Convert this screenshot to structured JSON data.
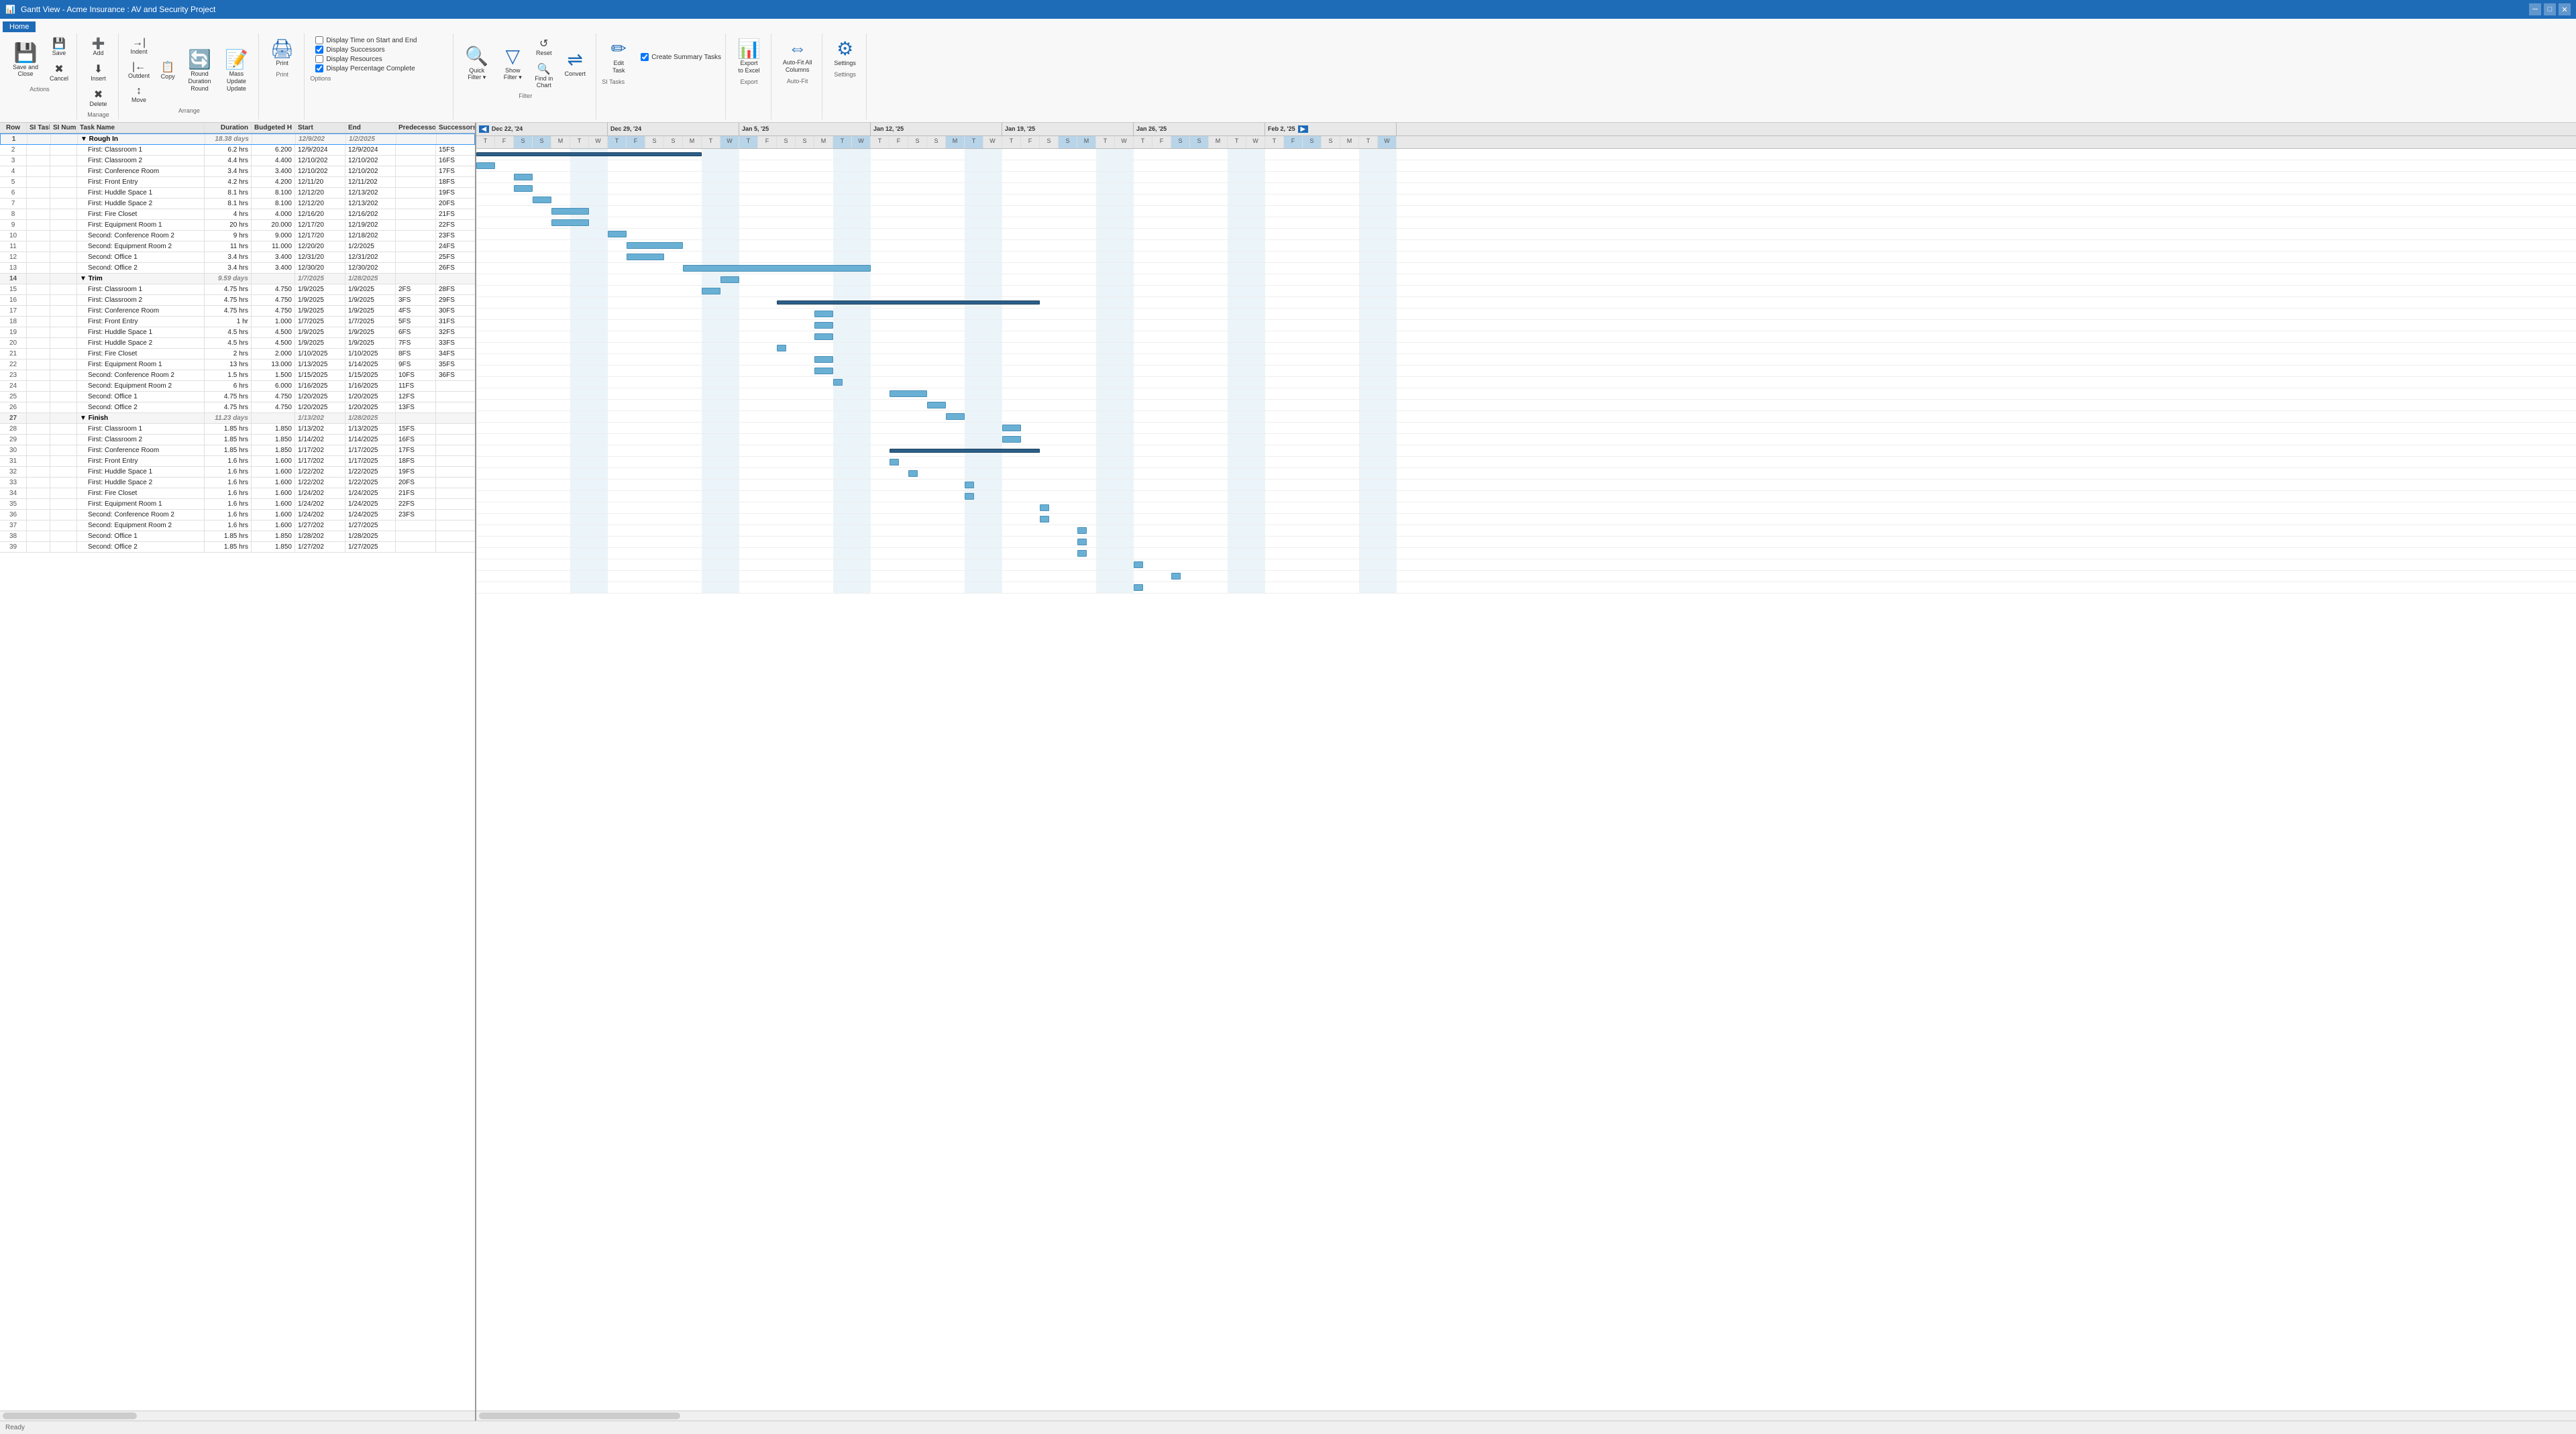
{
  "app": {
    "title": "Gantt View - Acme Insurance : AV and Security Project",
    "home_tab": "Home"
  },
  "ribbon": {
    "groups": [
      {
        "name": "Actions",
        "buttons": [
          {
            "id": "save-close",
            "label": "Save and\nClose",
            "icon": "💾"
          },
          {
            "id": "save",
            "label": "Save",
            "icon": "💾"
          },
          {
            "id": "cancel",
            "label": "Cancel",
            "icon": "✖"
          }
        ]
      },
      {
        "name": "Manage",
        "buttons": [
          {
            "id": "add",
            "label": "Add",
            "icon": "➕"
          },
          {
            "id": "insert",
            "label": "Insert",
            "icon": "⬇"
          },
          {
            "id": "delete",
            "label": "Delete",
            "icon": "✖"
          }
        ]
      },
      {
        "name": "Arrange",
        "buttons": [
          {
            "id": "indent",
            "label": "Indent",
            "icon": "→"
          },
          {
            "id": "outdent",
            "label": "Outdent",
            "icon": "←"
          },
          {
            "id": "move",
            "label": "Move",
            "icon": "↕"
          },
          {
            "id": "copy",
            "label": "Copy",
            "icon": "📋"
          },
          {
            "id": "round-duration",
            "label": "Round\nDuration\nRound",
            "icon": "🔄"
          },
          {
            "id": "mass-update",
            "label": "Mass\nUpdate\nUpdate",
            "icon": "📝"
          }
        ]
      },
      {
        "name": "Print",
        "buttons": [
          {
            "id": "print",
            "label": "Print",
            "icon": "🖨"
          }
        ]
      },
      {
        "name": "Options",
        "checkboxes": [
          {
            "id": "display-time",
            "label": "Display Time on Start and End",
            "checked": false
          },
          {
            "id": "display-resources",
            "label": "Display Resources",
            "checked": false
          },
          {
            "id": "display-pct",
            "label": "Display Percentage Complete",
            "checked": true
          }
        ],
        "checkbox_successors": {
          "label": "Display Successors",
          "checked": true
        }
      },
      {
        "name": "Filter",
        "buttons": [
          {
            "id": "quick-filter",
            "label": "Quick\nFilter ▾",
            "icon": "🔍"
          },
          {
            "id": "show-filter",
            "label": "Show\nFilter ▾",
            "icon": "🔽"
          },
          {
            "id": "reset",
            "label": "Reset",
            "icon": "↺"
          },
          {
            "id": "find-in-chart",
            "label": "Find in\nChart",
            "icon": "🔍"
          },
          {
            "id": "convert",
            "label": "Convert",
            "icon": "🔄"
          }
        ]
      },
      {
        "name": "SI Tasks",
        "buttons": [
          {
            "id": "edit-task",
            "label": "Edit\nTask",
            "icon": "✏"
          }
        ],
        "checkbox_create": {
          "label": "Create Summary Tasks",
          "checked": true
        }
      },
      {
        "name": "Export",
        "buttons": [
          {
            "id": "export-excel",
            "label": "Export\nto Excel",
            "icon": "📊"
          }
        ]
      },
      {
        "name": "Auto-Fit",
        "buttons": [
          {
            "id": "auto-fit-all",
            "label": "Auto-Fit All\nColumns",
            "icon": "⇔"
          }
        ]
      },
      {
        "name": "Settings",
        "buttons": [
          {
            "id": "settings",
            "label": "Settings",
            "icon": "⚙"
          }
        ]
      }
    ]
  },
  "grid": {
    "columns": [
      "Row",
      "SI Task",
      "SI Number",
      "Task Name",
      "Duration",
      "Budgeted H",
      "Start",
      "End",
      "Predecessors",
      "Successors"
    ],
    "rows": [
      {
        "row": 1,
        "si_task": "",
        "si_number": "",
        "task_name": "Rough In",
        "duration": "18.38 days",
        "budgeted": "",
        "start": "12/9/202",
        "end": "1/2/2025",
        "pred": "",
        "succ": "",
        "type": "summary",
        "level": 0
      },
      {
        "row": 2,
        "si_task": "",
        "si_number": "",
        "task_name": "First: Classroom 1",
        "duration": "6.2 hrs",
        "budgeted": "6.200",
        "start": "12/9/2024",
        "end": "12/9/2024",
        "pred": "",
        "succ": "15FS",
        "type": "task",
        "level": 1
      },
      {
        "row": 3,
        "si_task": "",
        "si_number": "",
        "task_name": "First: Classroom 2",
        "duration": "4.4 hrs",
        "budgeted": "4.400",
        "start": "12/10/202",
        "end": "12/10/202",
        "pred": "",
        "succ": "16FS",
        "type": "task",
        "level": 1
      },
      {
        "row": 4,
        "si_task": "",
        "si_number": "",
        "task_name": "First: Conference Room",
        "duration": "3.4 hrs",
        "budgeted": "3.400",
        "start": "12/10/202",
        "end": "12/10/202",
        "pred": "",
        "succ": "17FS",
        "type": "task",
        "level": 1
      },
      {
        "row": 5,
        "si_task": "",
        "si_number": "",
        "task_name": "First: Front Entry",
        "duration": "4.2 hrs",
        "budgeted": "4.200",
        "start": "12/11/20",
        "end": "12/11/202",
        "pred": "",
        "succ": "18FS",
        "type": "task",
        "level": 1
      },
      {
        "row": 6,
        "si_task": "",
        "si_number": "",
        "task_name": "First: Huddle Space 1",
        "duration": "8.1 hrs",
        "budgeted": "8.100",
        "start": "12/12/20",
        "end": "12/13/202",
        "pred": "",
        "succ": "19FS",
        "type": "task",
        "level": 1
      },
      {
        "row": 7,
        "si_task": "",
        "si_number": "",
        "task_name": "First: Huddle Space 2",
        "duration": "8.1 hrs",
        "budgeted": "8.100",
        "start": "12/12/20",
        "end": "12/13/202",
        "pred": "",
        "succ": "20FS",
        "type": "task",
        "level": 1
      },
      {
        "row": 8,
        "si_task": "",
        "si_number": "",
        "task_name": "First: Fire Closet",
        "duration": "4 hrs",
        "budgeted": "4.000",
        "start": "12/16/20",
        "end": "12/16/202",
        "pred": "",
        "succ": "21FS",
        "type": "task",
        "level": 1
      },
      {
        "row": 9,
        "si_task": "",
        "si_number": "",
        "task_name": "First: Equipment Room 1",
        "duration": "20 hrs",
        "budgeted": "20.000",
        "start": "12/17/20",
        "end": "12/19/202",
        "pred": "",
        "succ": "22FS",
        "type": "task",
        "level": 1
      },
      {
        "row": 10,
        "si_task": "",
        "si_number": "",
        "task_name": "Second: Conference Room 2",
        "duration": "9 hrs",
        "budgeted": "9.000",
        "start": "12/17/20",
        "end": "12/18/202",
        "pred": "",
        "succ": "23FS",
        "type": "task",
        "level": 1
      },
      {
        "row": 11,
        "si_task": "",
        "si_number": "",
        "task_name": "Second: Equipment Room 2",
        "duration": "11 hrs",
        "budgeted": "11.000",
        "start": "12/20/20",
        "end": "1/2/2025",
        "pred": "",
        "succ": "24FS",
        "type": "task",
        "level": 1
      },
      {
        "row": 12,
        "si_task": "",
        "si_number": "",
        "task_name": "Second: Office 1",
        "duration": "3.4 hrs",
        "budgeted": "3.400",
        "start": "12/31/20",
        "end": "12/31/202",
        "pred": "",
        "succ": "25FS",
        "type": "task",
        "level": 1
      },
      {
        "row": 13,
        "si_task": "",
        "si_number": "",
        "task_name": "Second: Office 2",
        "duration": "3.4 hrs",
        "budgeted": "3.400",
        "start": "12/30/20",
        "end": "12/30/202",
        "pred": "",
        "succ": "26FS",
        "type": "task",
        "level": 1
      },
      {
        "row": 14,
        "si_task": "",
        "si_number": "",
        "task_name": "Trim",
        "duration": "9.59 days",
        "budgeted": "",
        "start": "1/7/2025",
        "end": "1/28/2025",
        "pred": "",
        "succ": "",
        "type": "summary",
        "level": 0
      },
      {
        "row": 15,
        "si_task": "",
        "si_number": "",
        "task_name": "First: Classroom 1",
        "duration": "4.75 hrs",
        "budgeted": "4.750",
        "start": "1/9/2025",
        "end": "1/9/2025",
        "pred": "2FS",
        "succ": "28FS",
        "type": "task",
        "level": 1
      },
      {
        "row": 16,
        "si_task": "",
        "si_number": "",
        "task_name": "First: Classroom 2",
        "duration": "4.75 hrs",
        "budgeted": "4.750",
        "start": "1/9/2025",
        "end": "1/9/2025",
        "pred": "3FS",
        "succ": "29FS",
        "type": "task",
        "level": 1
      },
      {
        "row": 17,
        "si_task": "",
        "si_number": "",
        "task_name": "First: Conference Room",
        "duration": "4.75 hrs",
        "budgeted": "4.750",
        "start": "1/9/2025",
        "end": "1/9/2025",
        "pred": "4FS",
        "succ": "30FS",
        "type": "task",
        "level": 1
      },
      {
        "row": 18,
        "si_task": "",
        "si_number": "",
        "task_name": "First: Front Entry",
        "duration": "1 hr",
        "budgeted": "1.000",
        "start": "1/7/2025",
        "end": "1/7/2025",
        "pred": "5FS",
        "succ": "31FS",
        "type": "task",
        "level": 1
      },
      {
        "row": 19,
        "si_task": "",
        "si_number": "",
        "task_name": "First: Huddle Space 1",
        "duration": "4.5 hrs",
        "budgeted": "4.500",
        "start": "1/9/2025",
        "end": "1/9/2025",
        "pred": "6FS",
        "succ": "32FS",
        "type": "task",
        "level": 1
      },
      {
        "row": 20,
        "si_task": "",
        "si_number": "",
        "task_name": "First: Huddle Space 2",
        "duration": "4.5 hrs",
        "budgeted": "4.500",
        "start": "1/9/2025",
        "end": "1/9/2025",
        "pred": "7FS",
        "succ": "33FS",
        "type": "task",
        "level": 1
      },
      {
        "row": 21,
        "si_task": "",
        "si_number": "",
        "task_name": "First: Fire Closet",
        "duration": "2 hrs",
        "budgeted": "2.000",
        "start": "1/10/2025",
        "end": "1/10/2025",
        "pred": "8FS",
        "succ": "34FS",
        "type": "task",
        "level": 1
      },
      {
        "row": 22,
        "si_task": "",
        "si_number": "",
        "task_name": "First: Equipment Room 1",
        "duration": "13 hrs",
        "budgeted": "13.000",
        "start": "1/13/2025",
        "end": "1/14/2025",
        "pred": "9FS",
        "succ": "35FS",
        "type": "task",
        "level": 1
      },
      {
        "row": 23,
        "si_task": "",
        "si_number": "",
        "task_name": "Second: Conference Room 2",
        "duration": "1.5 hrs",
        "budgeted": "1.500",
        "start": "1/15/2025",
        "end": "1/15/2025",
        "pred": "10FS",
        "succ": "36FS",
        "type": "task",
        "level": 1
      },
      {
        "row": 24,
        "si_task": "",
        "si_number": "",
        "task_name": "Second: Equipment Room 2",
        "duration": "6 hrs",
        "budgeted": "6.000",
        "start": "1/16/2025",
        "end": "1/16/2025",
        "pred": "11FS",
        "succ": "",
        "type": "task",
        "level": 1
      },
      {
        "row": 25,
        "si_task": "",
        "si_number": "",
        "task_name": "Second: Office 1",
        "duration": "4.75 hrs",
        "budgeted": "4.750",
        "start": "1/20/2025",
        "end": "1/20/2025",
        "pred": "12FS",
        "succ": "",
        "type": "task",
        "level": 1
      },
      {
        "row": 26,
        "si_task": "",
        "si_number": "",
        "task_name": "Second: Office 2",
        "duration": "4.75 hrs",
        "budgeted": "4.750",
        "start": "1/20/2025",
        "end": "1/20/2025",
        "pred": "13FS",
        "succ": "",
        "type": "task",
        "level": 1
      },
      {
        "row": 27,
        "si_task": "",
        "si_number": "",
        "task_name": "Finish",
        "duration": "11.23 days",
        "budgeted": "",
        "start": "1/13/202",
        "end": "1/28/2025",
        "pred": "",
        "succ": "",
        "type": "summary",
        "level": 0
      },
      {
        "row": 28,
        "si_task": "",
        "si_number": "",
        "task_name": "First: Classroom 1",
        "duration": "1.85 hrs",
        "budgeted": "1.850",
        "start": "1/13/202",
        "end": "1/13/2025",
        "pred": "15FS",
        "succ": "",
        "type": "task",
        "level": 1
      },
      {
        "row": 29,
        "si_task": "",
        "si_number": "",
        "task_name": "First: Classroom 2",
        "duration": "1.85 hrs",
        "budgeted": "1.850",
        "start": "1/14/202",
        "end": "1/14/2025",
        "pred": "16FS",
        "succ": "",
        "type": "task",
        "level": 1
      },
      {
        "row": 30,
        "si_task": "",
        "si_number": "",
        "task_name": "First: Conference Room",
        "duration": "1.85 hrs",
        "budgeted": "1.850",
        "start": "1/17/202",
        "end": "1/17/2025",
        "pred": "17FS",
        "succ": "",
        "type": "task",
        "level": 1
      },
      {
        "row": 31,
        "si_task": "",
        "si_number": "",
        "task_name": "First: Front Entry",
        "duration": "1.6 hrs",
        "budgeted": "1.600",
        "start": "1/17/202",
        "end": "1/17/2025",
        "pred": "18FS",
        "succ": "",
        "type": "task",
        "level": 1
      },
      {
        "row": 32,
        "si_task": "",
        "si_number": "",
        "task_name": "First: Huddle Space 1",
        "duration": "1.6 hrs",
        "budgeted": "1.600",
        "start": "1/22/202",
        "end": "1/22/2025",
        "pred": "19FS",
        "succ": "",
        "type": "task",
        "level": 1
      },
      {
        "row": 33,
        "si_task": "",
        "si_number": "",
        "task_name": "First: Huddle Space 2",
        "duration": "1.6 hrs",
        "budgeted": "1.600",
        "start": "1/22/202",
        "end": "1/22/2025",
        "pred": "20FS",
        "succ": "",
        "type": "task",
        "level": 1
      },
      {
        "row": 34,
        "si_task": "",
        "si_number": "",
        "task_name": "First: Fire Closet",
        "duration": "1.6 hrs",
        "budgeted": "1.600",
        "start": "1/24/202",
        "end": "1/24/2025",
        "pred": "21FS",
        "succ": "",
        "type": "task",
        "level": 1
      },
      {
        "row": 35,
        "si_task": "",
        "si_number": "",
        "task_name": "First: Equipment Room 1",
        "duration": "1.6 hrs",
        "budgeted": "1.600",
        "start": "1/24/202",
        "end": "1/24/2025",
        "pred": "22FS",
        "succ": "",
        "type": "task",
        "level": 1
      },
      {
        "row": 36,
        "si_task": "",
        "si_number": "",
        "task_name": "Second: Conference Room 2",
        "duration": "1.6 hrs",
        "budgeted": "1.600",
        "start": "1/24/202",
        "end": "1/24/2025",
        "pred": "23FS",
        "succ": "",
        "type": "task",
        "level": 1
      },
      {
        "row": 37,
        "si_task": "",
        "si_number": "",
        "task_name": "Second: Equipment Room 2",
        "duration": "1.6 hrs",
        "budgeted": "1.600",
        "start": "1/27/202",
        "end": "1/27/2025",
        "pred": "",
        "succ": "",
        "type": "task",
        "level": 1
      },
      {
        "row": 38,
        "si_task": "",
        "si_number": "",
        "task_name": "Second: Office 1",
        "duration": "1.85 hrs",
        "budgeted": "1.850",
        "start": "1/28/202",
        "end": "1/28/2025",
        "pred": "",
        "succ": "",
        "type": "task",
        "level": 1
      },
      {
        "row": 39,
        "si_task": "",
        "si_number": "",
        "task_name": "Second: Office 2",
        "duration": "1.85 hrs",
        "budgeted": "1.850",
        "start": "1/27/202",
        "end": "1/27/2025",
        "pred": "",
        "succ": "",
        "type": "task",
        "level": 1
      }
    ]
  },
  "gantt": {
    "week_labels": [
      "Dec 22, '24",
      "Dec 29, '24",
      "Jan 5, '25",
      "Jan 12, '25",
      "Jan 19, '25",
      "Jan 26, '25",
      "Feb 2, '25"
    ],
    "day_labels": [
      "T",
      "F",
      "S",
      "S",
      "M",
      "T",
      "W",
      "T",
      "F",
      "S",
      "S",
      "M",
      "T",
      "W",
      "T",
      "F",
      "S",
      "S",
      "M",
      "T",
      "W",
      "T",
      "F",
      "S",
      "S",
      "M",
      "T",
      "W",
      "T",
      "F",
      "S",
      "S",
      "M",
      "T",
      "W",
      "T",
      "F",
      "S",
      "S",
      "M",
      "T",
      "W",
      "T",
      "F",
      "S",
      "S",
      "M",
      "T",
      "W"
    ]
  }
}
